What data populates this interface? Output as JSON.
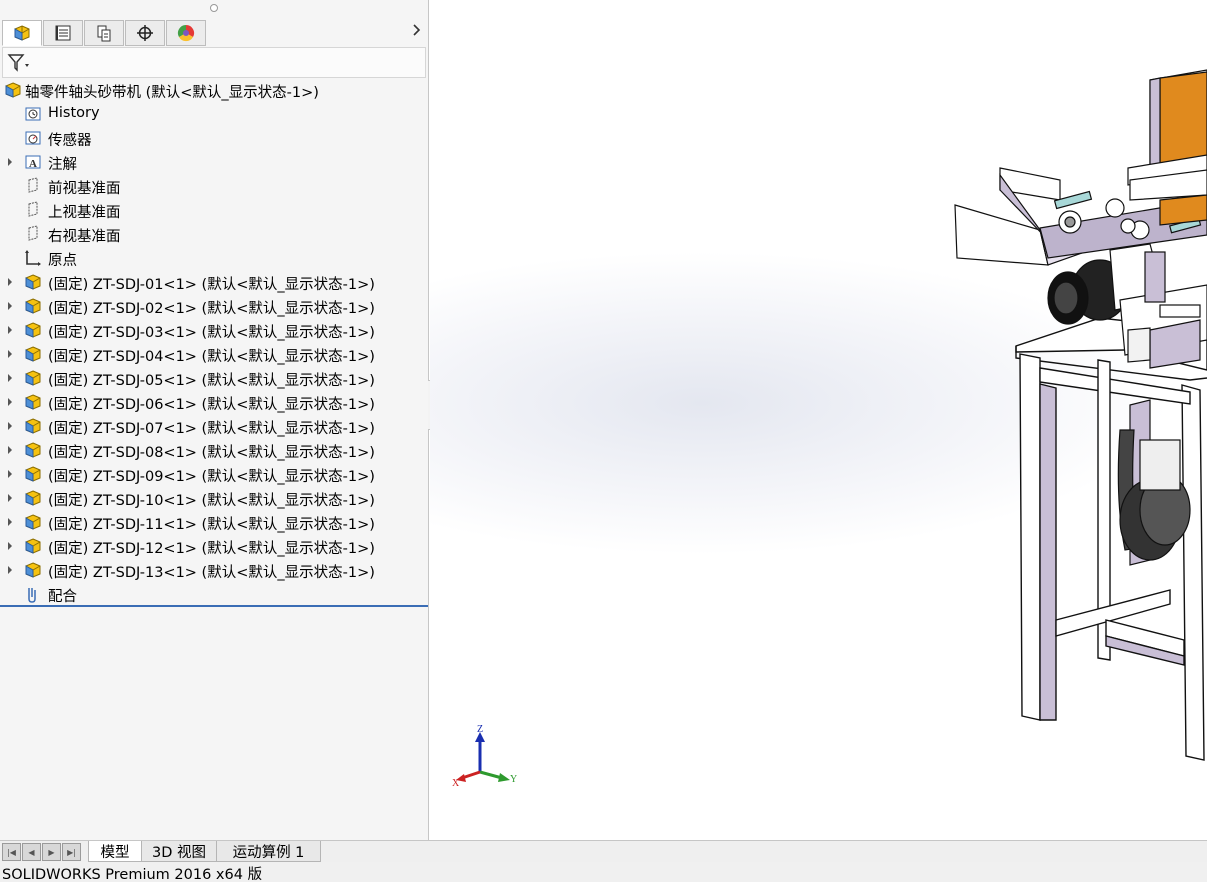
{
  "tabs": [
    {
      "name": "featuremanager"
    },
    {
      "name": "propertymanager"
    },
    {
      "name": "configurationmanager"
    },
    {
      "name": "dimxpertmanager"
    },
    {
      "name": "displaymanager"
    }
  ],
  "tree": {
    "root": "轴零件轴头砂带机  (默认<默认_显示状态-1>)",
    "items": [
      {
        "label": "History",
        "icon": "history-icon",
        "expand": false
      },
      {
        "label": "传感器",
        "icon": "sensor-icon",
        "expand": false
      },
      {
        "label": "注解",
        "icon": "annotation-icon",
        "expand": true
      },
      {
        "label": "前视基准面",
        "icon": "plane-icon",
        "expand": false
      },
      {
        "label": "上视基准面",
        "icon": "plane-icon",
        "expand": false
      },
      {
        "label": "右视基准面",
        "icon": "plane-icon",
        "expand": false
      },
      {
        "label": "原点",
        "icon": "origin-icon",
        "expand": false
      },
      {
        "label": "(固定) ZT-SDJ-01<1> (默认<默认_显示状态-1>)",
        "icon": "part-icon",
        "expand": true
      },
      {
        "label": "(固定) ZT-SDJ-02<1> (默认<默认_显示状态-1>)",
        "icon": "part-icon",
        "expand": true
      },
      {
        "label": "(固定) ZT-SDJ-03<1> (默认<默认_显示状态-1>)",
        "icon": "part-icon",
        "expand": true
      },
      {
        "label": "(固定) ZT-SDJ-04<1> (默认<默认_显示状态-1>)",
        "icon": "part-icon",
        "expand": true
      },
      {
        "label": "(固定) ZT-SDJ-05<1> (默认<默认_显示状态-1>)",
        "icon": "part-icon",
        "expand": true
      },
      {
        "label": "(固定) ZT-SDJ-06<1> (默认<默认_显示状态-1>)",
        "icon": "part-icon",
        "expand": true
      },
      {
        "label": "(固定) ZT-SDJ-07<1> (默认<默认_显示状态-1>)",
        "icon": "part-icon",
        "expand": true
      },
      {
        "label": "(固定) ZT-SDJ-08<1> (默认<默认_显示状态-1>)",
        "icon": "part-icon",
        "expand": true
      },
      {
        "label": "(固定) ZT-SDJ-09<1> (默认<默认_显示状态-1>)",
        "icon": "part-icon",
        "expand": true
      },
      {
        "label": "(固定) ZT-SDJ-10<1> (默认<默认_显示状态-1>)",
        "icon": "part-icon",
        "expand": true
      },
      {
        "label": "(固定) ZT-SDJ-11<1> (默认<默认_显示状态-1>)",
        "icon": "part-icon",
        "expand": true
      },
      {
        "label": "(固定) ZT-SDJ-12<1> (默认<默认_显示状态-1>)",
        "icon": "part-icon",
        "expand": true
      },
      {
        "label": "(固定) ZT-SDJ-13<1> (默认<默认_显示状态-1>)",
        "icon": "part-icon",
        "expand": true
      },
      {
        "label": "配合",
        "icon": "mates-icon",
        "expand": false
      }
    ]
  },
  "triad": {
    "x": "X",
    "y": "Y",
    "z": "Z"
  },
  "bottom_tabs": [
    "模型",
    "3D 视图",
    "运动算例 1"
  ],
  "status": "SOLIDWORKS Premium 2016 x64 版",
  "colors": {
    "accent": "#3a6db5",
    "belt": "#e08a1e",
    "frame_shade": "#c9bfd6"
  }
}
